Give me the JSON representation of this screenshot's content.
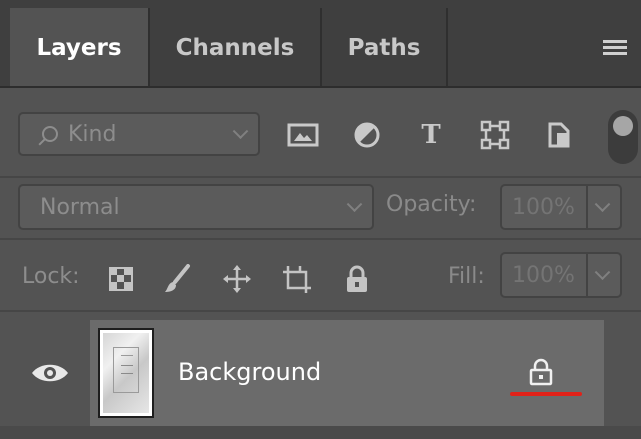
{
  "tabs": [
    {
      "label": "Layers",
      "active": true
    },
    {
      "label": "Channels",
      "active": false
    },
    {
      "label": "Paths",
      "active": false
    }
  ],
  "panel_menu_icon": "hamburger-menu-icon",
  "filter": {
    "kind_label": "Kind",
    "icons": [
      "pixel-layer-filter-icon",
      "adjustment-layer-filter-icon",
      "type-layer-filter-icon",
      "shape-layer-filter-icon",
      "smart-object-filter-icon"
    ],
    "type_glyph": "T"
  },
  "blend": {
    "mode": "Normal",
    "opacity_label": "Opacity:",
    "opacity_value": "100%"
  },
  "lock": {
    "label": "Lock:",
    "icons": [
      "lock-transparent-pixels-icon",
      "lock-image-pixels-icon",
      "lock-position-icon",
      "lock-artboard-icon",
      "lock-all-icon"
    ],
    "fill_label": "Fill:",
    "fill_value": "100%"
  },
  "layer": {
    "name": "Background",
    "visible": true,
    "locked": true
  },
  "colors": {
    "panel_bg": "#535353",
    "tab_bar_bg": "#3f3f3f",
    "selected_layer_bg": "#6b6b6b",
    "annotation_underline": "#e12219"
  }
}
